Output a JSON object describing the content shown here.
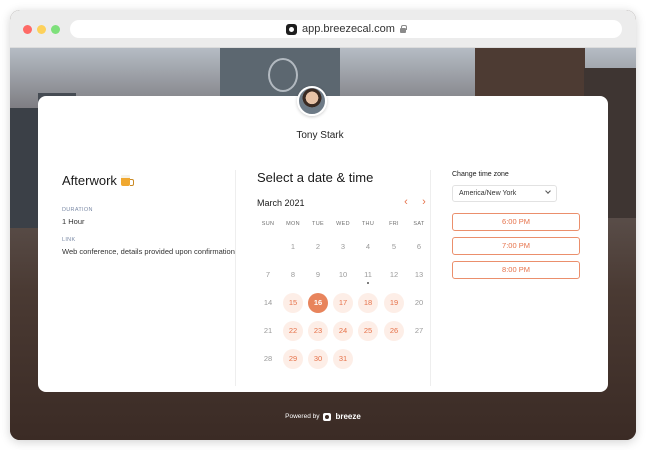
{
  "browser": {
    "url": "app.breezecal.com"
  },
  "host": {
    "name": "Tony Stark"
  },
  "event": {
    "title": "Afterwork",
    "duration_label": "DURATION",
    "duration_value": "1 Hour",
    "link_label": "LINK",
    "link_value": "Web conference, details provided upon confirmation"
  },
  "calendar": {
    "heading": "Select a date & time",
    "month": "March 2021",
    "prev_icon": "chevron-left-icon",
    "next_icon": "chevron-right-icon",
    "weekdays": [
      "SUN",
      "MON",
      "TUE",
      "WED",
      "THU",
      "FRI",
      "SAT"
    ],
    "weeks": [
      [
        "",
        "1",
        "2",
        "3",
        "4",
        "5",
        "6"
      ],
      [
        "7",
        "8",
        "9",
        "10",
        "11",
        "12",
        "13"
      ],
      [
        "14",
        "15",
        "16",
        "17",
        "18",
        "19",
        "20"
      ],
      [
        "21",
        "22",
        "23",
        "24",
        "25",
        "26",
        "27"
      ],
      [
        "28",
        "29",
        "30",
        "31",
        "",
        "",
        ""
      ]
    ],
    "available_days": [
      "15",
      "16",
      "17",
      "18",
      "19",
      "22",
      "23",
      "24",
      "25",
      "26",
      "29",
      "30",
      "31"
    ],
    "selected_day": "16",
    "today": "11",
    "colors": {
      "accent": "#e6724a",
      "available_bg": "#fdeee7",
      "selected_bg": "#e8845c"
    }
  },
  "timezone": {
    "label": "Change time zone",
    "selected": "America/New York"
  },
  "slots": [
    "6:00 PM",
    "7:00 PM",
    "8:00 PM"
  ],
  "footer": {
    "powered_by": "Powered by",
    "brand": "breeze"
  }
}
